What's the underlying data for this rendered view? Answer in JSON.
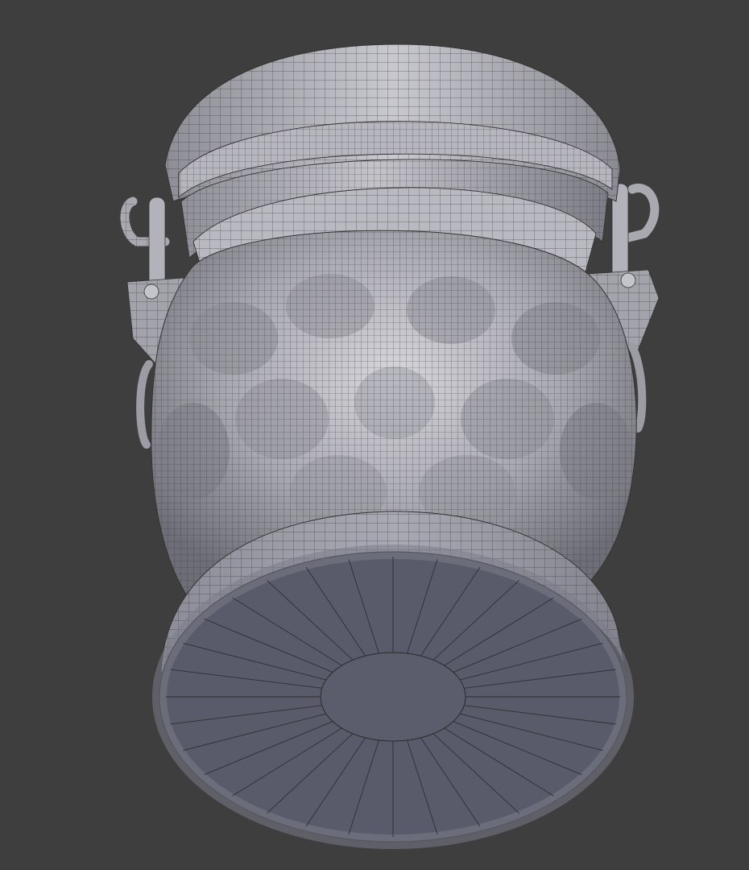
{
  "scene": {
    "subject": "wireframe-jar-model",
    "colors": {
      "background": "#3e3e3e",
      "mesh_light": "#c9c9cf",
      "mesh_mid": "#9d9da6",
      "mesh_dark": "#6f6f78",
      "base_face": "#5c5e6e",
      "wire": "#2a2a2a"
    }
  }
}
